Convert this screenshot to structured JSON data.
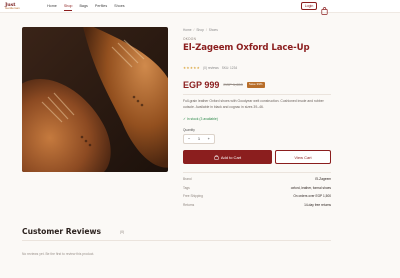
{
  "header": {
    "logo": {
      "mark": "Just",
      "sub": "Gentleman"
    },
    "nav": [
      {
        "label": "Home",
        "active": false
      },
      {
        "label": "Shop",
        "active": true
      },
      {
        "label": "Bags",
        "active": false
      },
      {
        "label": "Perfiles",
        "active": false
      },
      {
        "label": "Shoes",
        "active": false
      }
    ],
    "login_label": "Login",
    "cart_icon": "bag-icon"
  },
  "breadcrumb": [
    "Home",
    "Shop",
    "Shoes"
  ],
  "product": {
    "brand": "OKDON",
    "title": "El-Zageem Oxford Lace-Up",
    "rating_stars": "★★★★★",
    "rating_reviews": "(0) reviews",
    "rating_sku": "SKU: 1234",
    "price": "EGP 999",
    "old_price": "EGP 1,650",
    "sale_badge": "Save 39%",
    "description": "Full-grain leather Oxford shoes with Goodyear welt construction. Cushioned insole and rubber outsole. Available in black and cognac in sizes 39–46.",
    "stock": "✓ In stock (3 available)",
    "quantity_label": "Quantity",
    "quantity_value": "1",
    "add_to_cart": "Add to Cart",
    "view_cart": "View Cart"
  },
  "specs": [
    {
      "key": "Brand",
      "value": "El-Zageem"
    },
    {
      "key": "Tags",
      "value": "oxford, leather, formal shoes"
    },
    {
      "key": "Free Shipping",
      "value": "On orders over EGP 1,500"
    },
    {
      "key": "Returns",
      "value": "14-day free returns"
    }
  ],
  "reviews": {
    "title": "Customer Reviews",
    "count": "(0)",
    "empty_text": "No reviews yet. Be the first to review this product."
  },
  "colors": {
    "accent": "#8b1e1e",
    "sale": "#b86e2a",
    "stock": "#2f8a4c"
  }
}
